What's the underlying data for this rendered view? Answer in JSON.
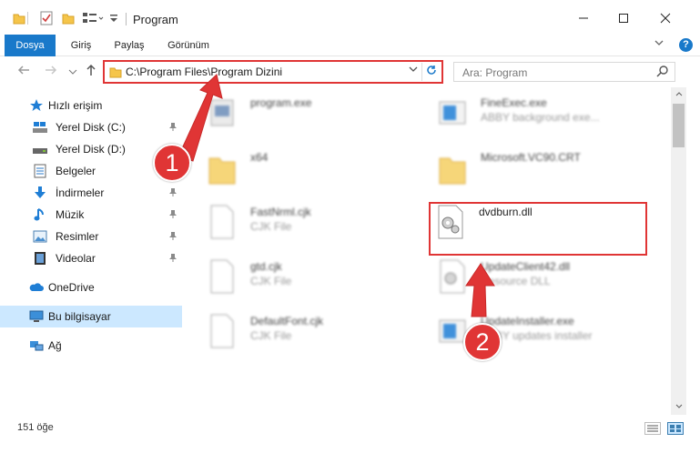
{
  "window": {
    "title": "Program",
    "minimize": "—",
    "maximize": "☐",
    "close": "✕"
  },
  "ribbon": {
    "tabs": [
      "Dosya",
      "Giriş",
      "Paylaş",
      "Görünüm"
    ],
    "active_tab": "Dosya",
    "help": "?"
  },
  "address": {
    "path": "C:\\Program Files\\Program Dizini",
    "search_placeholder": "Ara: Program"
  },
  "sidebar": {
    "quick_access": "Hızlı erişim",
    "items": [
      {
        "label": "Yerel Disk (C:)",
        "icon": "drive-c-icon",
        "pinned": true
      },
      {
        "label": "Yerel Disk (D:)",
        "icon": "drive-d-icon",
        "pinned": true
      },
      {
        "label": "Belgeler",
        "icon": "documents-icon",
        "pinned": true
      },
      {
        "label": "İndirmeler",
        "icon": "downloads-icon",
        "pinned": true
      },
      {
        "label": "Müzik",
        "icon": "music-icon",
        "pinned": true
      },
      {
        "label": "Resimler",
        "icon": "pictures-icon",
        "pinned": true
      },
      {
        "label": "Videolar",
        "icon": "videos-icon",
        "pinned": true
      }
    ],
    "onedrive": "OneDrive",
    "this_pc": "Bu bilgisayar",
    "network": "Ağ"
  },
  "files": [
    {
      "name": "program.exe",
      "sub": "",
      "icon": "exe-icon",
      "blurred": true
    },
    {
      "name": "FineExec.exe",
      "sub": "ABBY background exe...",
      "icon": "exe-icon",
      "blurred": true
    },
    {
      "name": "x64",
      "sub": "",
      "icon": "folder-icon",
      "blurred": true
    },
    {
      "name": "Microsoft.VC90.CRT",
      "sub": "",
      "icon": "folder-icon",
      "blurred": true
    },
    {
      "name": "FastNrml.cjk",
      "sub": "CJK File",
      "icon": "file-icon",
      "blurred": true
    },
    {
      "name": "dvdburn.dll",
      "sub": "",
      "icon": "dll-icon",
      "blurred": false
    },
    {
      "name": "gtd.cjk",
      "sub": "CJK File",
      "icon": "file-icon",
      "blurred": true
    },
    {
      "name": "UpdateClient42.dll",
      "sub": "Resource DLL",
      "icon": "dll-icon",
      "blurred": true
    },
    {
      "name": "DefaultFont.cjk",
      "sub": "CJK File",
      "icon": "file-icon",
      "blurred": true
    },
    {
      "name": "UpdateInstaller.exe",
      "sub": "ABBY updates installer",
      "icon": "exe-icon",
      "blurred": true
    }
  ],
  "status": {
    "count": "151 öğe"
  },
  "annotations": [
    "1",
    "2"
  ],
  "colors": {
    "accent": "#1979ca",
    "highlight": "#e03535",
    "selected": "#cce8ff"
  }
}
